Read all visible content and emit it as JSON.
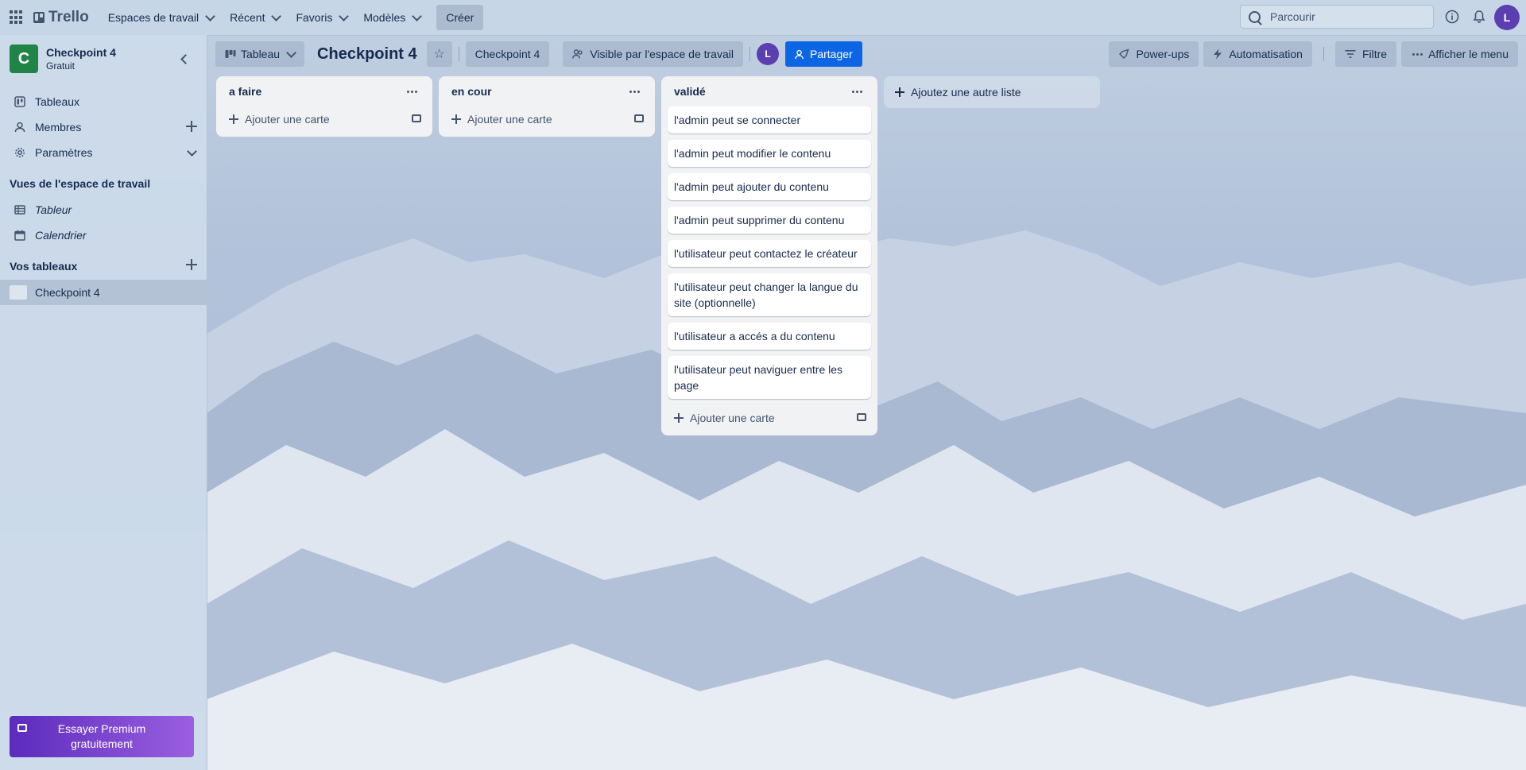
{
  "topnav": {
    "logo": "Trello",
    "menus": [
      "Espaces de travail",
      "Récent",
      "Favoris",
      "Modèles"
    ],
    "create": "Créer",
    "search_placeholder": "Parcourir",
    "avatar": "L"
  },
  "sidebar": {
    "workspace_initial": "C",
    "workspace_name": "Checkpoint 4",
    "workspace_plan": "Gratuit",
    "items": [
      {
        "label": "Tableaux",
        "icon": "board-icon"
      },
      {
        "label": "Membres",
        "icon": "person-icon"
      },
      {
        "label": "Paramètres",
        "icon": "gear-icon"
      }
    ],
    "views_title": "Vues de l'espace de travail",
    "views": [
      {
        "label": "Tableur",
        "icon": "table-icon"
      },
      {
        "label": "Calendrier",
        "icon": "calendar-icon"
      }
    ],
    "boards_title": "Vos tableaux",
    "boards": [
      "Checkpoint 4"
    ],
    "premium": "Essayer Premium gratuitement"
  },
  "board": {
    "view": "Tableau",
    "title": "Checkpoint 4",
    "workspace": "Checkpoint 4",
    "visibility": "Visible par l'espace de travail",
    "member": "L",
    "share": "Partager",
    "powerups": "Power-ups",
    "automation": "Automatisation",
    "filter": "Filtre",
    "menu": "Afficher le menu",
    "add_card": "Ajouter une carte",
    "add_list": "Ajoutez une autre liste",
    "lists": [
      {
        "title": "a faire",
        "cards": []
      },
      {
        "title": "en cour",
        "cards": []
      },
      {
        "title": "validé",
        "cards": [
          "l'admin peut se connecter",
          "l'admin peut modifier le contenu",
          "l'admin peut ajouter du contenu",
          "l'admin peut supprimer du contenu",
          "l'utilisateur peut contactez le créateur",
          "l'utilisateur peut changer la langue du site (optionnelle)",
          "l'utilisateur a accés a du contenu",
          "l'utilisateur peut naviguer entre les page"
        ]
      }
    ]
  },
  "colors": {
    "accent": "#0c66e4",
    "workspace_logo": "#1f8445",
    "avatar": "#5b3fb0",
    "premium_start": "#5b2bbd",
    "premium_end": "#9b5fe0"
  }
}
